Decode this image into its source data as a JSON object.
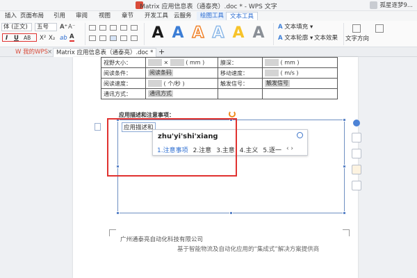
{
  "window": {
    "title": "Matrix 应用信息表（通泰亮）.doc * - WPS 文字",
    "user": "孤星逐梦9..."
  },
  "menu": {
    "items": [
      "插入",
      "页面布局",
      "引用",
      "审阅",
      "视图",
      "章节",
      "开发工具",
      "云服务",
      "绘图工具",
      "文本工具"
    ],
    "active": "文本工具"
  },
  "ribbon": {
    "style_combo": "体 (正文)",
    "size_combo": "五号",
    "italic": "I",
    "underline": "U",
    "ab": "AB",
    "superscript": "X²",
    "subscript": "X₂",
    "font_color": "A",
    "highlight": "ab",
    "text_styles": [
      "A",
      "A",
      "A",
      "A",
      "A",
      "A"
    ],
    "text_fill": "文本填充",
    "text_outline": "文本轮廓",
    "text_effect": "文本效果",
    "text_direction": "文字方向",
    "colors": {
      "style_black": "#1a1a1a",
      "style_blue": "#3c7ed6",
      "style_orange": "#f0832b",
      "style_lightblue": "#8db9e8",
      "style_yellow": "#f7c32a",
      "style_gray": "#8a8f96",
      "highlight_red": "#e0312f"
    }
  },
  "doctabs": {
    "home": "我的WPS",
    "document": "Matrix 应用信息表（通泰亮）.doc *",
    "add": "+"
  },
  "document": {
    "table_rows": [
      {
        "c1": "视野大小：",
        "c2": "( mm )",
        "c3": "膜深：",
        "c4": "( mm )"
      },
      {
        "c1": "阅读条件：",
        "c2": "阅读条码",
        "c3": "移动速度：",
        "c4": "( m/s )"
      },
      {
        "c1": "阅读速度：",
        "c2": "( 个/秒 )",
        "c3": "触发信号：",
        "c4": "触发信号"
      },
      {
        "c1": "通讯方式：",
        "c2": "通讯方式",
        "c3": "",
        "c4": ""
      }
    ],
    "note_title": "应用描述和注意事项：",
    "box_text": "应用描述和",
    "ime_pinyin": "zhu'yi'shi'xiang",
    "ime_candidates": [
      "1.注意事项",
      "2.注意",
      "3.主意",
      "4.主义",
      "5.逐一"
    ],
    "ime_nav": "‹ ›",
    "footer_company": "广州通泰亮自动化科技有限公司",
    "footer_slogan": "基于智能物流及自动化应用的“集成式”解决方案提供商"
  }
}
